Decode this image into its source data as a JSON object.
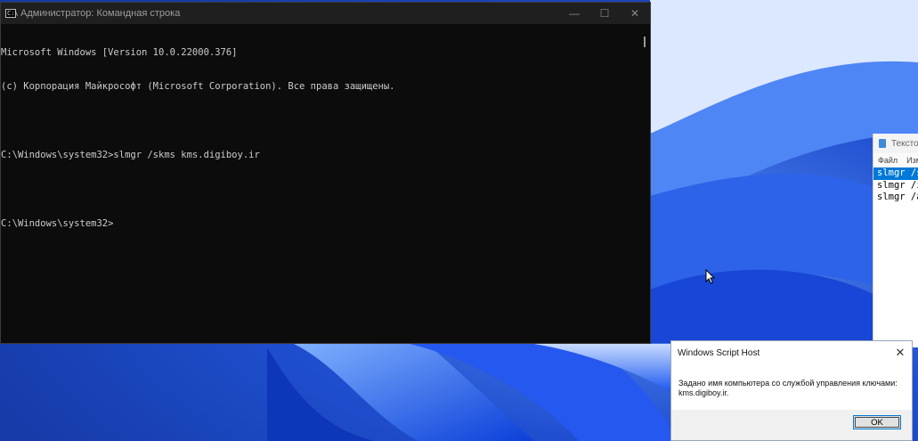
{
  "cmd": {
    "title": "Администратор: Командная строка",
    "icon": "cmd-icon",
    "lines": [
      "Microsoft Windows [Version 10.0.22000.376]",
      "(c) Корпорация Майкрософт (Microsoft Corporation). Все права защищены.",
      "",
      "C:\\Windows\\system32>slmgr /skms kms.digiboy.ir",
      "",
      "C:\\Windows\\system32>"
    ]
  },
  "notepad": {
    "title": "Тексто",
    "menu": [
      "Файл",
      "Изм"
    ],
    "lines": [
      "slmgr /s",
      "slmgr /i",
      "slmgr /a"
    ]
  },
  "msgbox": {
    "title": "Windows Script Host",
    "message_line1": "Задано имя компьютера со службой управления ключами:",
    "message_line2": "kms.digiboy.ir.",
    "ok_label": "OK"
  },
  "colors": {
    "cmd_bg": "#0c0c0c",
    "cmd_text": "#cccccc",
    "selection": "#0078d7",
    "wallpaper": "#2a55c8"
  }
}
